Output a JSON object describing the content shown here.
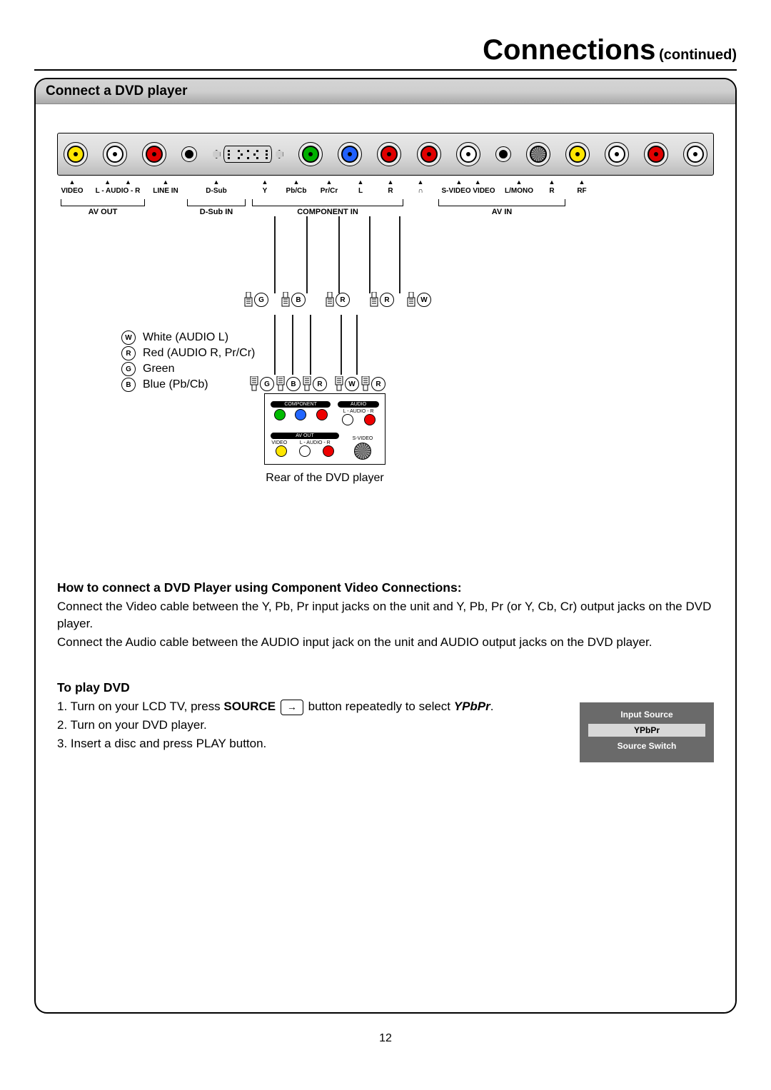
{
  "page_title_main": "Connections",
  "page_title_sub": "(continued)",
  "section_heading": "Connect a DVD player",
  "panel_labels": {
    "video": "VIDEO",
    "l_audio_r": "L - AUDIO - R",
    "line_in": "LINE IN",
    "dsub": "D-Sub",
    "y": "Y",
    "pbcb": "Pb/Cb",
    "prcr": "Pr/Cr",
    "l": "L",
    "r": "R",
    "headphone": "∩",
    "svideo_video": "S-VIDEO VIDEO",
    "lmono": "L/MONO",
    "r2": "R",
    "rf": "RF",
    "av_out": "AV OUT",
    "dsub_in": "D-Sub IN",
    "component_in": "COMPONENT IN",
    "av_in": "AV IN"
  },
  "legend": {
    "w": "White (AUDIO L)",
    "r": "Red (AUDIO R, Pr/Cr)",
    "g": "Green",
    "b": "Blue (Pb/Cb)"
  },
  "dvd_rear": {
    "caption": "Rear of the DVD player",
    "component": "COMPONENT",
    "audio": "AUDIO",
    "laudio_r": "L - AUDIO - R",
    "av_out": "AV OUT",
    "video": "VIDEO",
    "svideo": "S-VIDEO"
  },
  "howto_heading": "How to connect a DVD Player using Component Video Connections:",
  "howto_p1": "Connect the Video cable between the Y, Pb, Pr input jacks on the unit and Y, Pb, Pr (or Y, Cb, Cr) output jacks on the DVD player.",
  "howto_p2": "Connect the Audio cable between the AUDIO input jack on the unit and AUDIO output jacks on the DVD player.",
  "play_heading": "To play DVD",
  "play_step1_a": "1. Turn on your LCD TV, press ",
  "play_step1_b": "SOURCE",
  "play_step1_c": " button repeatedly to select ",
  "play_step1_d": "YPbPr",
  "play_step1_e": ".",
  "play_step2": "2. Turn on your DVD player.",
  "play_step3": "3. Insert a disc and press PLAY button.",
  "osd": {
    "title": "Input Source",
    "selected": "YPbPr",
    "footer": "Source Switch"
  },
  "source_btn_glyph": "↪",
  "page_number": "12",
  "plug_codes": {
    "g": "G",
    "b": "B",
    "r": "R",
    "w": "W"
  }
}
